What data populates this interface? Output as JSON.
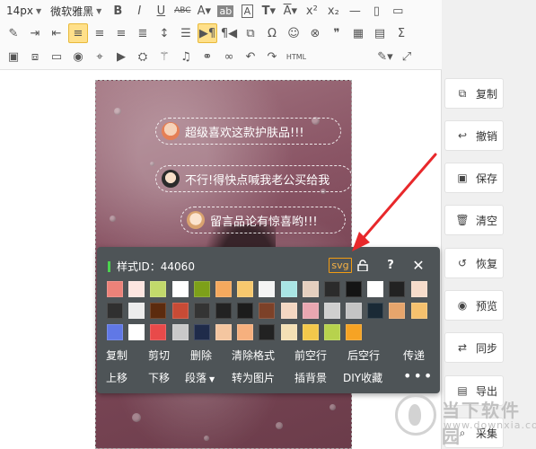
{
  "toolbar": {
    "font_size": "14px",
    "font_family": "微软雅黑",
    "row1_icons": [
      "bold-icon",
      "italic-icon",
      "underline-icon",
      "strikethrough-icon",
      "font-color-icon",
      "background-color-icon",
      "border-text-icon",
      "text-transform-icon",
      "overline-icon",
      "superscript-icon",
      "subscript-icon",
      "new-doc-icon",
      "page-icon"
    ],
    "row2_icons": [
      "eraser-icon",
      "indent-icon",
      "outdent-icon",
      "align-left-icon",
      "align-center-icon",
      "align-right-icon",
      "justify-icon",
      "line-height-icon",
      "paragraph-spacing-icon",
      "ltr-icon",
      "rtl-icon",
      "special-char-icon",
      "omega-icon",
      "emoji-icon",
      "link-icon",
      "quote-icon",
      "table-icon",
      "template-icon",
      "sigma-icon"
    ],
    "row3_icons": [
      "image-icon",
      "multi-image-icon",
      "video-box-icon",
      "record-icon",
      "map-icon",
      "video-icon",
      "brush-icon",
      "magic-icon",
      "music-icon",
      "unlink-icon",
      "link2-icon",
      "undo-icon",
      "redo-icon"
    ],
    "row3_text": "HTML"
  },
  "canvas": {
    "bubbles": [
      {
        "text": "超级喜欢这款护肤品!!!"
      },
      {
        "text": "不行!得快点喊我老公买给我"
      },
      {
        "text": "留言品论有惊喜哟!!!"
      }
    ]
  },
  "popup": {
    "style_id": "样式ID：44060",
    "svg_label": "svg",
    "swatch_rows": [
      [
        "#ec8279",
        "#fde5e0",
        "#c2d96b",
        "#ffffff",
        "#7da019",
        "#f5a95e",
        "#f7c86e",
        "#f4f4f4",
        "#a9e5e4",
        "#e4cfbf",
        "#2b2b2b",
        "#141414",
        "#ffffff",
        "#222222",
        "#f6dccb"
      ],
      [
        "#303030",
        "#ececec",
        "#5c2b0e",
        "#c84b36",
        "#343434",
        "#222222",
        "#1c1c1c",
        "#7c4128",
        "#f4d7c2",
        "#e9a7b1",
        "#cfcfcf",
        "#c4c4c4",
        "#1a2a36",
        "#e6a56c",
        "#f5c16e"
      ],
      [
        "#6078e6",
        "#ffffff",
        "#e84a4a",
        "#c9c9c9",
        "#1f2b4a",
        "#f4c6a0",
        "#f6b07e",
        "#222222",
        "#f4e0b5",
        "#f3c84b",
        "#b7d24d",
        "#f6a324"
      ]
    ],
    "actions_row1": [
      "复制",
      "剪切",
      "删除",
      "清除格式",
      "前空行",
      "后空行",
      "传递"
    ],
    "actions_row2": [
      "上移",
      "下移",
      "段落",
      "转为图片",
      "插背景",
      "DIY收藏",
      "•••"
    ]
  },
  "side_panel": [
    {
      "label": "复制",
      "icon": "copy-icon"
    },
    {
      "label": "撤销",
      "icon": "undo-icon"
    },
    {
      "label": "保存",
      "icon": "save-icon"
    },
    {
      "label": "清空",
      "icon": "trash-icon"
    },
    {
      "label": "恢复",
      "icon": "restore-icon"
    },
    {
      "label": "预览",
      "icon": "eye-icon"
    },
    {
      "label": "同步",
      "icon": "sync-icon"
    },
    {
      "label": "导出",
      "icon": "export-icon"
    },
    {
      "label": "采集",
      "icon": "search-icon"
    }
  ],
  "watermark": {
    "name": "当下软件园",
    "url": "www.downxia.com"
  },
  "colors": {
    "popup_bg": "#4e5457",
    "accent_orange": "#f39c12",
    "id_bar": "#4bd34f",
    "arrow": "#e8282b"
  }
}
